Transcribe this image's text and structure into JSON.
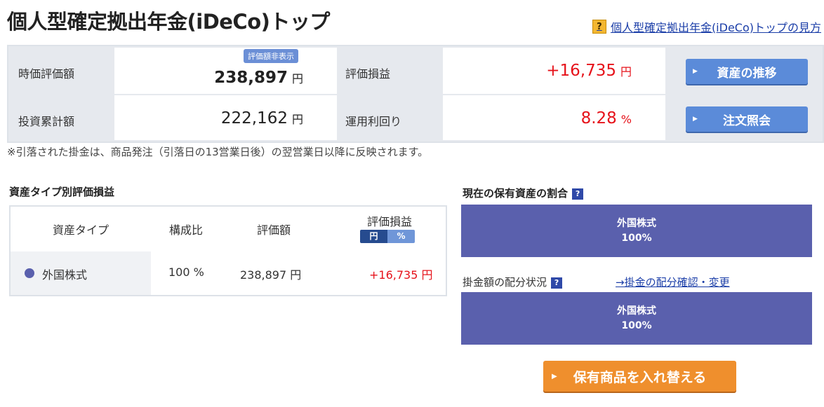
{
  "header": {
    "title": "個人型確定拠出年金(iDeCo)トップ",
    "help_icon": "?",
    "help_link": "個人型確定拠出年金(iDeCo)トップの見方"
  },
  "summary": {
    "market_value_label": "時価評価額",
    "hide_badge": "評価額非表示",
    "market_value": "238,897",
    "yen": "円",
    "pl_label": "評価損益",
    "pl_value": "+16,735",
    "invested_label": "投資累計額",
    "invested_value": "222,162",
    "return_label": "運用利回り",
    "return_value": "8.28",
    "percent": "%",
    "btn_history": "資産の推移",
    "btn_orders": "注文照会"
  },
  "note": "※引落された掛金は、商品発注（引落日の13営業日後）の翌営業日以降に反映されます。",
  "asset_table": {
    "title": "資産タイプ別評価損益",
    "headers": {
      "type": "資産タイプ",
      "ratio": "構成比",
      "value": "評価額",
      "pl": "評価損益"
    },
    "toggle": {
      "yen": "円",
      "pct": "%"
    },
    "rows": [
      {
        "type": "外国株式",
        "ratio": "100 %",
        "value": "238,897 円",
        "pl": "+16,735 円",
        "color": "#5a60ad"
      }
    ]
  },
  "holdings": {
    "title": "現在の保有資産の割合",
    "help_icon": "?",
    "bar": {
      "label": "外国株式",
      "pct": "100%"
    }
  },
  "allocation": {
    "title": "掛金額の配分状況",
    "help_icon": "?",
    "link": "→掛金の配分確認・変更",
    "bar": {
      "label": "外国株式",
      "pct": "100%"
    }
  },
  "switch_button": "保有商品を入れ替える",
  "colors": {
    "accent_blue": "#5b8bd9",
    "bar_purple": "#5a60ad",
    "profit_red": "#e6121a",
    "orange": "#ef8f2d"
  }
}
